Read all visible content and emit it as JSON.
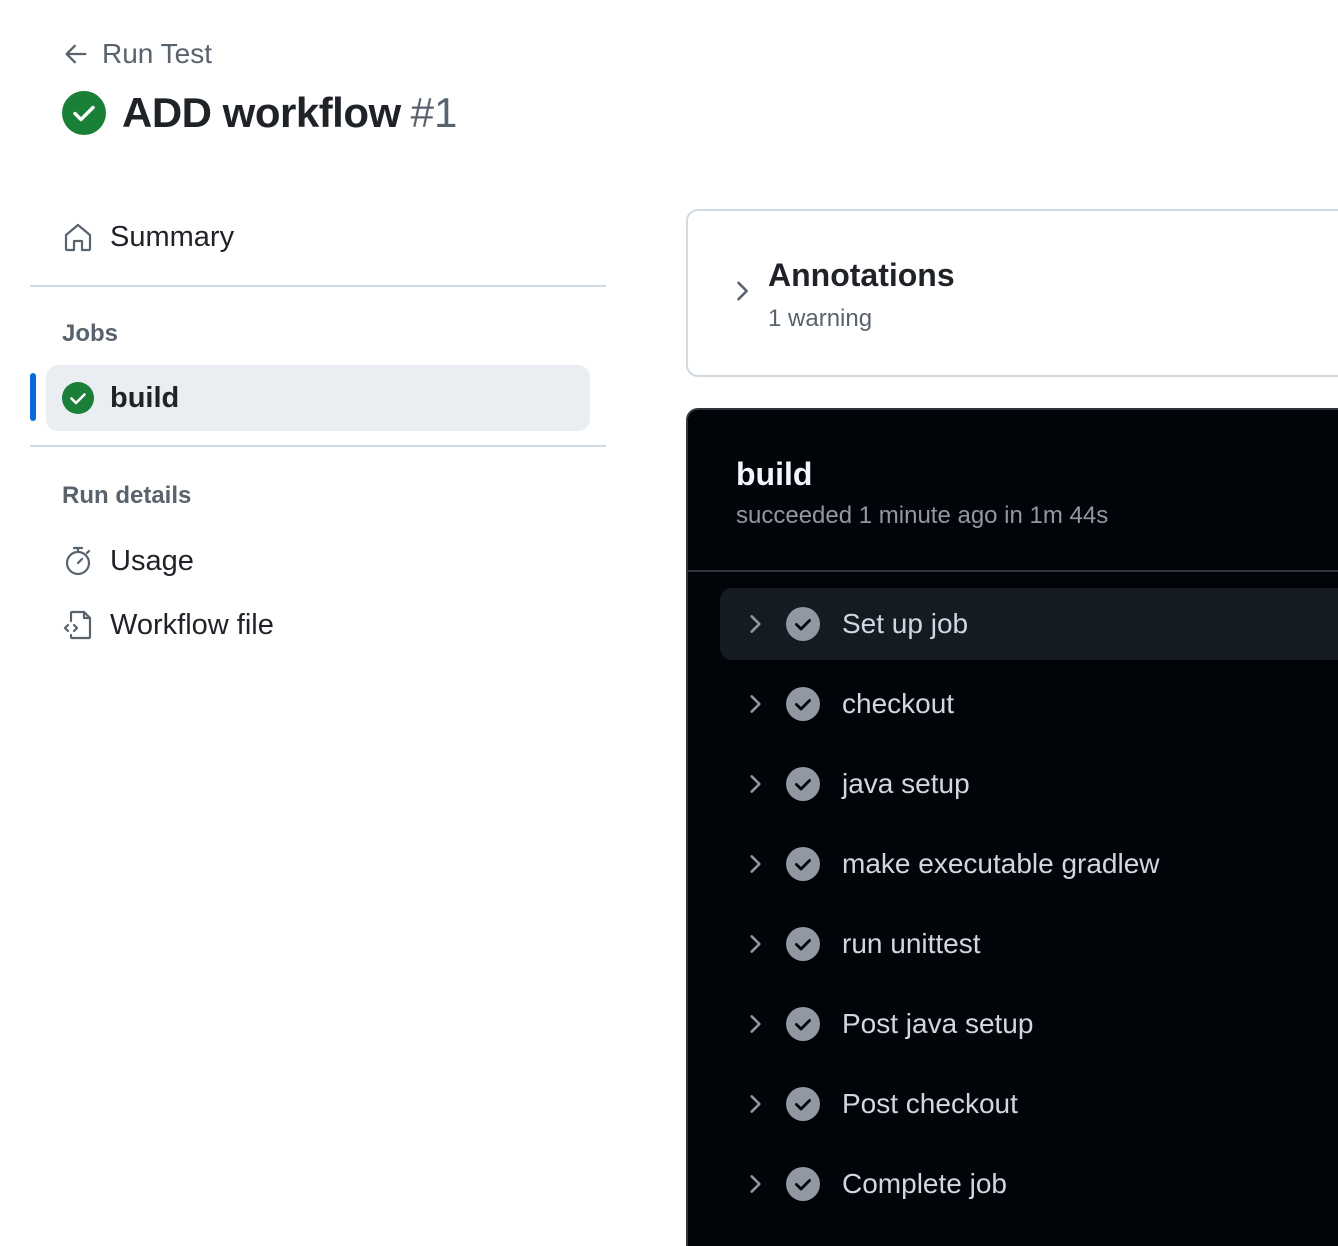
{
  "header": {
    "back_label": "Run Test",
    "title": "ADD workflow",
    "run_number": "#1"
  },
  "sidebar": {
    "summary_label": "Summary",
    "jobs_heading": "Jobs",
    "job": {
      "label": "build",
      "status": "success"
    },
    "run_details_heading": "Run details",
    "usage_label": "Usage",
    "workflow_file_label": "Workflow file"
  },
  "annotations": {
    "title": "Annotations",
    "subtitle": "1 warning"
  },
  "build": {
    "title": "build",
    "subtitle": "succeeded 1 minute ago in 1m 44s",
    "steps": [
      {
        "label": "Set up job"
      },
      {
        "label": "checkout"
      },
      {
        "label": "java setup"
      },
      {
        "label": "make executable gradlew"
      },
      {
        "label": "run unittest"
      },
      {
        "label": "Post java setup"
      },
      {
        "label": "Post checkout"
      },
      {
        "label": "Complete job"
      }
    ]
  },
  "colors": {
    "success": "#1a7f37",
    "accent": "#0969da",
    "panel_bg": "#010409",
    "step_check": "#9198a1"
  }
}
